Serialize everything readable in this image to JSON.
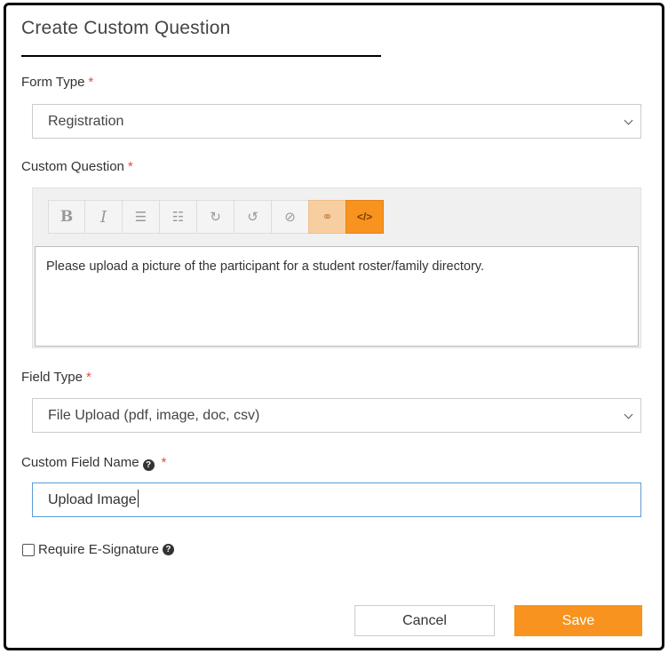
{
  "dialog": {
    "title": "Create Custom Question"
  },
  "form_type": {
    "label": "Form Type",
    "required_mark": "*",
    "value": "Registration"
  },
  "custom_question": {
    "label": "Custom Question",
    "required_mark": "*",
    "toolbar": {
      "bold": "B",
      "italic": "I",
      "unordered_list_icon": "☰",
      "ordered_list_icon": "☷",
      "redo_icon": "↻",
      "undo_icon": "↺",
      "clear_icon": "⊘",
      "link_icon": "⚭",
      "code_icon": "</>"
    },
    "content": "Please upload a picture of the participant for a student roster/family directory."
  },
  "field_type": {
    "label": "Field Type",
    "required_mark": "*",
    "value": "File Upload (pdf, image, doc, csv)"
  },
  "custom_field_name": {
    "label": "Custom Field Name",
    "help_icon": "?",
    "required_mark": "*",
    "value": "Upload Image"
  },
  "e_signature": {
    "label": "Require E-Signature",
    "help_icon": "?",
    "checked": false
  },
  "actions": {
    "cancel": "Cancel",
    "save": "Save"
  },
  "colors": {
    "accent": "#f7931e",
    "accent_light": "#f7cea0",
    "required": "#e74c3c",
    "focus": "#5b9bd5"
  }
}
